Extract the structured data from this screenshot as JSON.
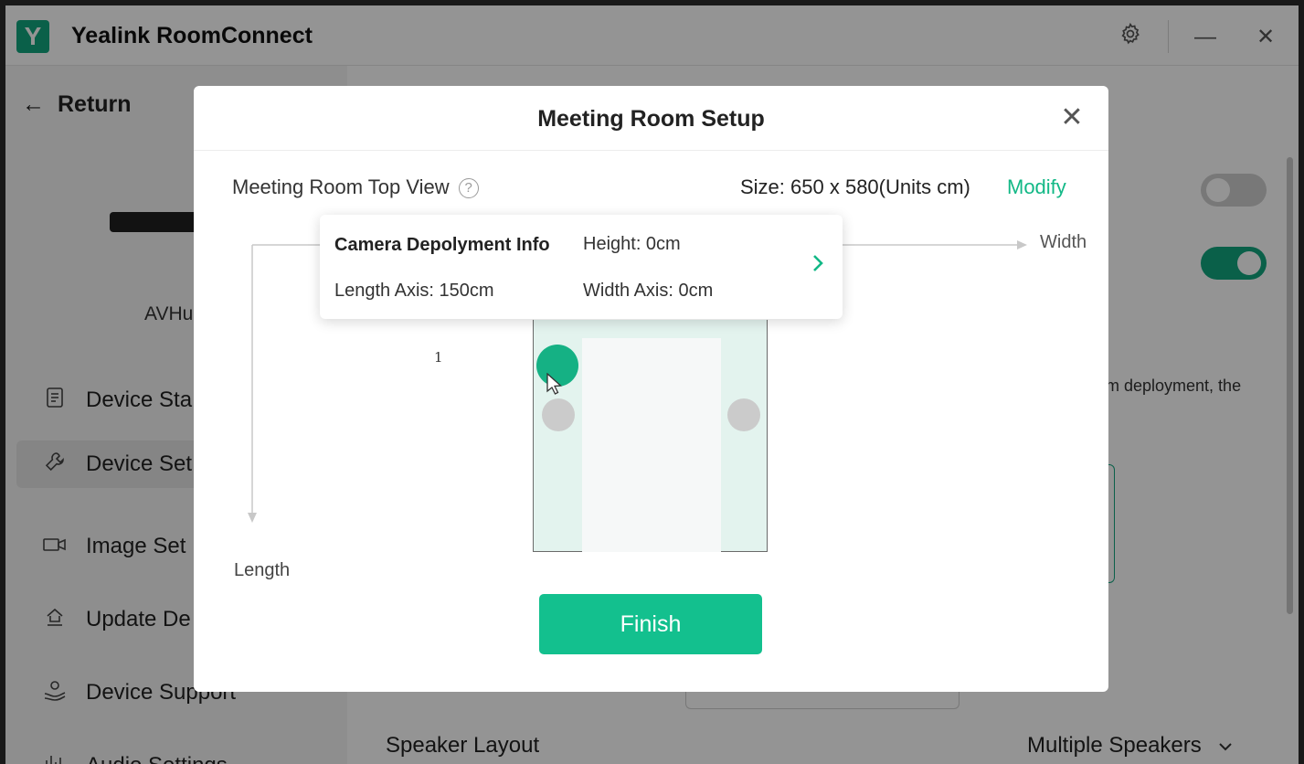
{
  "app": {
    "logo_letter": "Y",
    "title": "Yealink RoomConnect"
  },
  "titlebar": {
    "settings_icon": "gear-icon",
    "minimize_symbol": "—",
    "close_symbol": "✕"
  },
  "sidebar": {
    "return_arrow": "←",
    "return_label": "Return",
    "device_name": "AVHu",
    "items": [
      {
        "label": "Device Sta",
        "icon": "document-icon"
      },
      {
        "label": "Device Set",
        "icon": "wrench-icon",
        "active": true
      },
      {
        "label": "Image Set",
        "icon": "camera-icon"
      },
      {
        "label": "Update De",
        "icon": "upload-icon"
      },
      {
        "label": "Device Support",
        "icon": "support-icon"
      },
      {
        "label": "Audio Settings",
        "icon": "equalizer-icon"
      }
    ]
  },
  "main": {
    "toggle_1_on": false,
    "toggle_2_on": true,
    "background_description": "m deployment, the",
    "speaker_layout_label": "Speaker Layout",
    "speaker_layout_value": "Multiple Speakers",
    "speaker_chevron": "⌄"
  },
  "dialog": {
    "title": "Meeting Room Setup",
    "close_symbol": "✕",
    "top_view_label": "Meeting Room Top View",
    "help_symbol": "?",
    "size_text": "Size: 650 x 580(Units cm)",
    "modify_label": "Modify",
    "width_axis_label": "Width",
    "length_axis_label": "Length",
    "camera_number": "1",
    "camera_info": {
      "title": "Camera Depolyment Info",
      "height": "Height: 0cm",
      "length_axis": "Length Axis: 150cm",
      "width_axis": "Width Axis: 0cm",
      "chevron": "›"
    },
    "finish_label": "Finish"
  },
  "colors": {
    "accent": "#13c08e",
    "camera": "#15b184",
    "room_fill": "#e3f3ee",
    "seat": "#cbcbcb",
    "overlay": "rgba(0,0,0,0.42)"
  }
}
